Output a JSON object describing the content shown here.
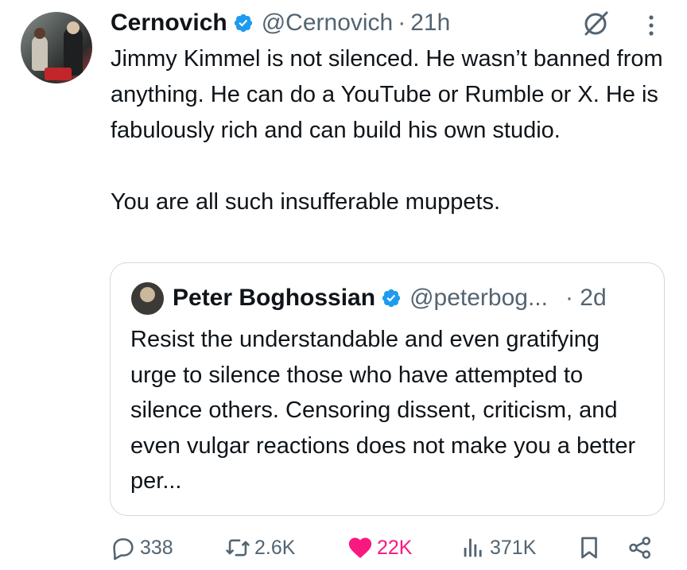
{
  "tweet": {
    "author_name": "Cernovich",
    "handle": "@Cernovich",
    "separator": "·",
    "time": "21h",
    "paragraphs": [
      "Jimmy Kimmel is not silenced. He wasn’t banned from anything. He can do a YouTube or Rumble or X. He is fabulously rich and can build his own studio.",
      "You are all such insufferable muppets."
    ]
  },
  "quote": {
    "author_name": "Peter Boghossian",
    "handle": "@peterbog...",
    "time": "· 2d",
    "text": "Resist the understandable and even gratifying urge to silence those who have attempted to silence others. Censoring dissent, criticism, and even vulgar reactions does not make you a better per..."
  },
  "actions": {
    "replies": "338",
    "reposts": "2.6K",
    "likes": "22K",
    "views": "371K"
  },
  "colors": {
    "verified": "#1d9bf0",
    "like": "#f91880",
    "muted": "#536471",
    "text": "#0f1419",
    "border": "#cfd9de"
  },
  "icons": [
    "verified-badge-icon",
    "grok-icon",
    "more-icon",
    "reply-icon",
    "repost-icon",
    "like-icon",
    "views-icon",
    "bookmark-icon",
    "share-icon"
  ]
}
